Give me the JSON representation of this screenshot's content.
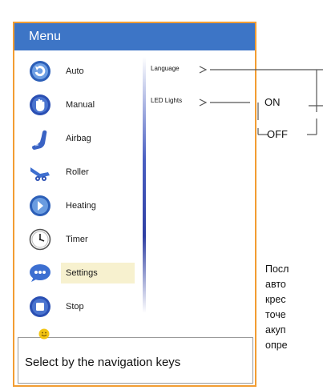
{
  "menu": {
    "title": "Menu",
    "items": [
      {
        "label": "Auto",
        "icon": "auto-icon"
      },
      {
        "label": "Manual",
        "icon": "hand-icon"
      },
      {
        "label": "Airbag",
        "icon": "leg-airbag-icon"
      },
      {
        "label": "Roller",
        "icon": "roller-icon"
      },
      {
        "label": "Heating",
        "icon": "heating-icon"
      },
      {
        "label": "Timer",
        "icon": "clock-icon"
      },
      {
        "label": "Settings",
        "icon": "chat-bubble-icon",
        "selected": true
      },
      {
        "label": "Stop",
        "icon": "stop-icon"
      }
    ],
    "hint": "Select by the navigation keys"
  },
  "settings": {
    "options": [
      "Language",
      "LED Lights"
    ],
    "led_states": [
      "ON",
      "OFF"
    ]
  },
  "side_text": [
    "Посл",
    "авто",
    "крес",
    "точе",
    "акуп",
    "опре"
  ],
  "colors": {
    "title_bar": "#3d75c6",
    "border": "#f29d33",
    "selected_bg": "#f7f1cf"
  }
}
